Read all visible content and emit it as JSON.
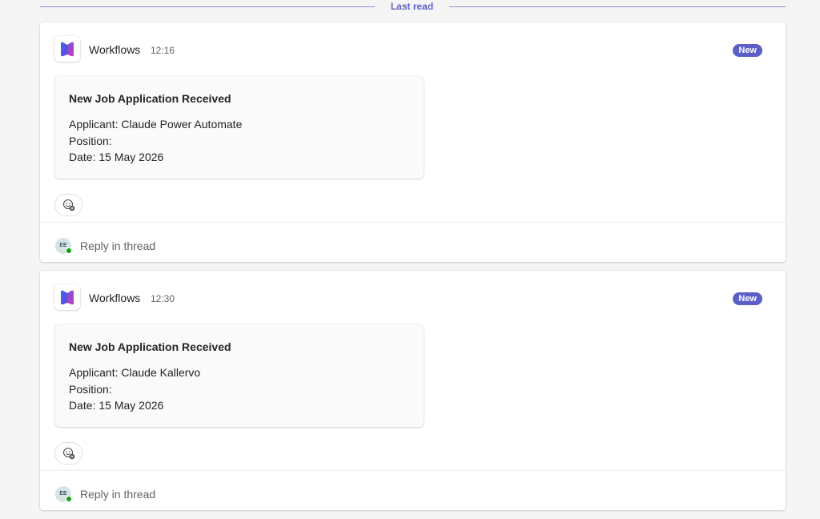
{
  "divider": {
    "label": "Last read"
  },
  "posts": [
    {
      "sender": "Workflows",
      "time": "12:16",
      "badge": "New",
      "card": {
        "title": "New Job Application Received",
        "applicant": "Applicant: Claude Power Automate",
        "position": "Position:",
        "date": "Date: 15 May 2026"
      },
      "reply": {
        "avatar": "EE",
        "label": "Reply in thread"
      }
    },
    {
      "sender": "Workflows",
      "time": "12:30",
      "badge": "New",
      "card": {
        "title": "New Job Application Received",
        "applicant": "Applicant: Claude Kallervo",
        "position": "Position:",
        "date": "Date: 15 May 2026"
      },
      "reply": {
        "avatar": "EE",
        "label": "Reply in thread"
      }
    }
  ],
  "colors": {
    "accent": "#5b5fc7",
    "presence": "#13a10e"
  },
  "icons": {
    "app": "workflows-icon",
    "reaction": "add-reaction-icon"
  }
}
